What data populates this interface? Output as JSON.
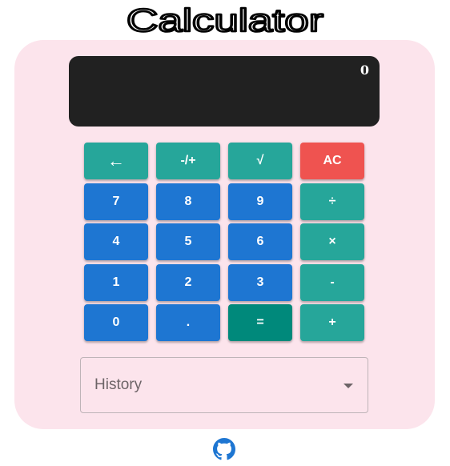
{
  "app": {
    "title": "Calculator"
  },
  "display": {
    "value": "0"
  },
  "keypad": {
    "keys": [
      {
        "label": "←",
        "color": "#26a69a"
      },
      {
        "label": "-/+",
        "color": "#26a69a"
      },
      {
        "label": "√",
        "color": "#26a69a"
      },
      {
        "label": "AC",
        "color": "#ef5350"
      },
      {
        "label": "7",
        "color": "#1e76d2"
      },
      {
        "label": "8",
        "color": "#1e76d2"
      },
      {
        "label": "9",
        "color": "#1e76d2"
      },
      {
        "label": "÷",
        "color": "#26a69a"
      },
      {
        "label": "4",
        "color": "#1e76d2"
      },
      {
        "label": "5",
        "color": "#1e76d2"
      },
      {
        "label": "6",
        "color": "#1e76d2"
      },
      {
        "label": "×",
        "color": "#26a69a"
      },
      {
        "label": "1",
        "color": "#1e76d2"
      },
      {
        "label": "2",
        "color": "#1e76d2"
      },
      {
        "label": "3",
        "color": "#1e76d2"
      },
      {
        "label": "-",
        "color": "#26a69a"
      },
      {
        "label": "0",
        "color": "#1e76d2"
      },
      {
        "label": ".",
        "color": "#1e76d2"
      },
      {
        "label": "=",
        "color": "#00897b"
      },
      {
        "label": "+",
        "color": "#26a69a"
      }
    ]
  },
  "history": {
    "label": "History"
  },
  "footer": {
    "icon": "github-icon"
  },
  "colors": {
    "card_background": "#fce4ec",
    "display_background": "#212121",
    "operator_key": "#26a69a",
    "digit_key": "#1e76d2",
    "clear_key": "#ef5350",
    "equals_key": "#00897b",
    "github_icon": "#1e76d2"
  }
}
